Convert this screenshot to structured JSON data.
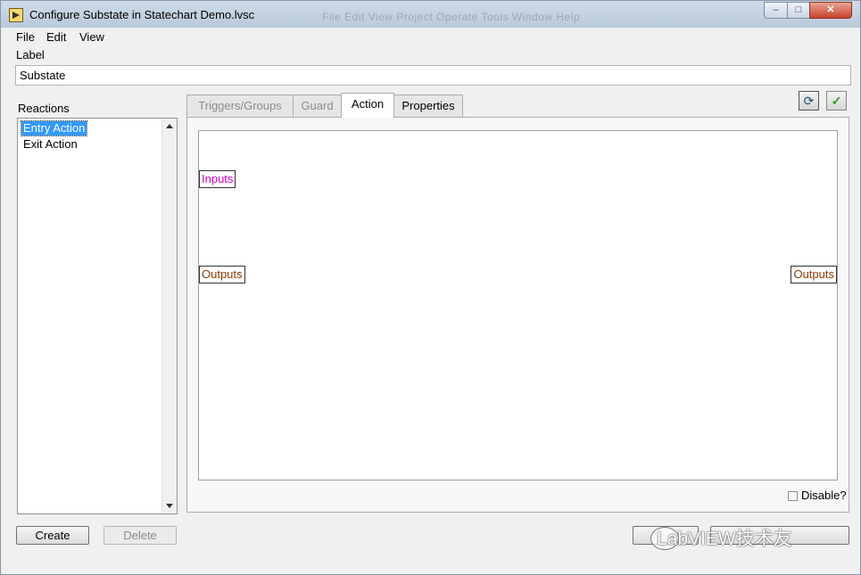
{
  "window": {
    "title": "Configure Substate in Statechart Demo.lvsc",
    "background_menu": "File   Edit   View   Project   Operate   Tools   Window   Help",
    "controls": {
      "minimize": "–",
      "maximize": "□",
      "close": "✕"
    }
  },
  "menubar": {
    "items": [
      {
        "label": "File"
      },
      {
        "label": "Edit"
      },
      {
        "label": "View"
      }
    ]
  },
  "label": {
    "caption": "Label",
    "value": "Substate"
  },
  "reactions": {
    "caption": "Reactions",
    "items": [
      {
        "label": "Entry Action",
        "selected": true
      },
      {
        "label": "Exit Action",
        "selected": false
      }
    ],
    "create_label": "Create",
    "delete_label": "Delete"
  },
  "tabs": [
    {
      "label": "Triggers/Groups",
      "state": "disabled"
    },
    {
      "label": "Guard",
      "state": "disabled"
    },
    {
      "label": "Action",
      "state": "active"
    },
    {
      "label": "Properties",
      "state": "normal"
    }
  ],
  "action_panel": {
    "inputs_label": "Inputs",
    "outputs_left_label": "Outputs",
    "outputs_right_label": "Outputs",
    "disable_label": "Disable?",
    "disable_checked": false
  },
  "toolbar": {
    "refresh_icon": "refresh-icon",
    "apply_icon": "checkmark-icon",
    "accent": "#2a9d2a"
  },
  "watermark": {
    "text": "LabVIEW技术友"
  },
  "colors": {
    "inputs": "#d100c8",
    "outputs": "#8a3a00",
    "selection": "#3399ff"
  }
}
